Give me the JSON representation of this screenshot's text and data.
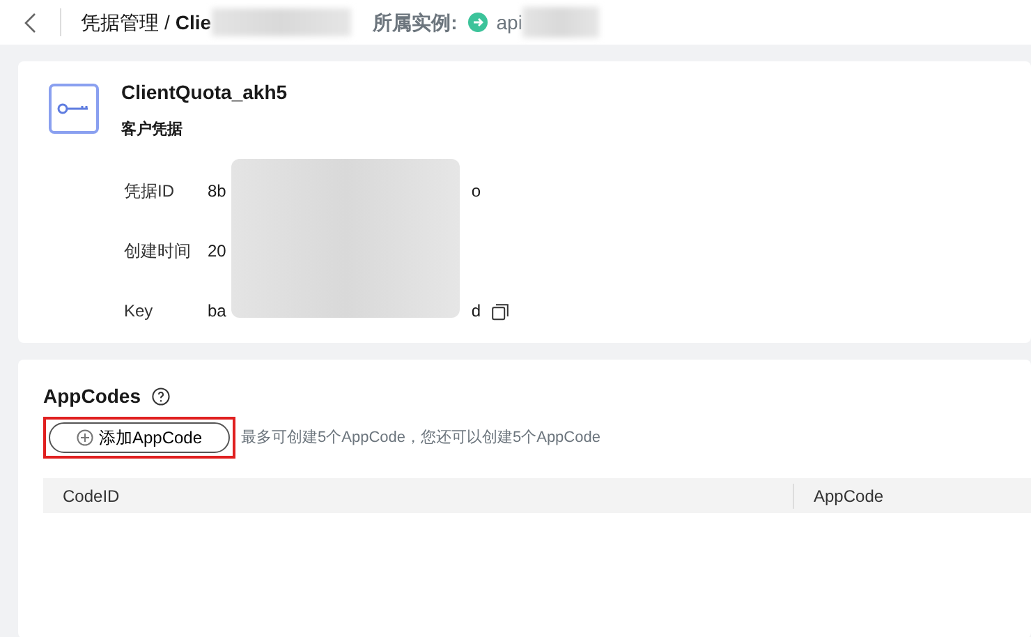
{
  "header": {
    "breadcrumb_parent": "凭据管理",
    "separator": "/",
    "current_visible": "Clie",
    "instance_label": "所属实例:",
    "instance_visible": "api"
  },
  "credential": {
    "name": "ClientQuota_akh5",
    "type": "客户凭据",
    "fields": [
      {
        "label": "凭据ID",
        "value_start": "8b",
        "value_end": "o",
        "copyable": false
      },
      {
        "label": "创建时间",
        "value_start": "20",
        "copyable": false
      },
      {
        "label": "Key",
        "value_start": "ba",
        "value_end": "d",
        "copyable": true
      }
    ]
  },
  "appcodes": {
    "title": "AppCodes",
    "add_button": "添加AppCode",
    "add_button_highlighted": true,
    "hint": "最多可创建5个AppCode，您还可以创建5个AppCode",
    "columns": [
      "CodeID",
      "AppCode"
    ]
  }
}
